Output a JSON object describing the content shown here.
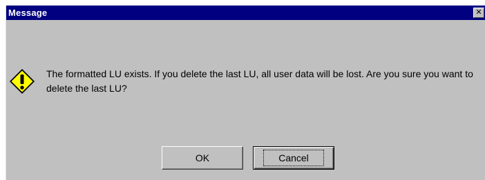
{
  "window": {
    "title": "Message",
    "close_glyph": "✕"
  },
  "dialog": {
    "icon": "warning-exclamation-icon",
    "message": "The formatted LU exists. If you delete the last LU, all user data will be lost. Are you sure you want to delete the last LU?"
  },
  "buttons": {
    "ok_label": "OK",
    "cancel_label": "Cancel"
  },
  "colors": {
    "titlebar": "#000080",
    "window_bg": "#c0c0c0",
    "icon_fill": "#ffff00"
  }
}
